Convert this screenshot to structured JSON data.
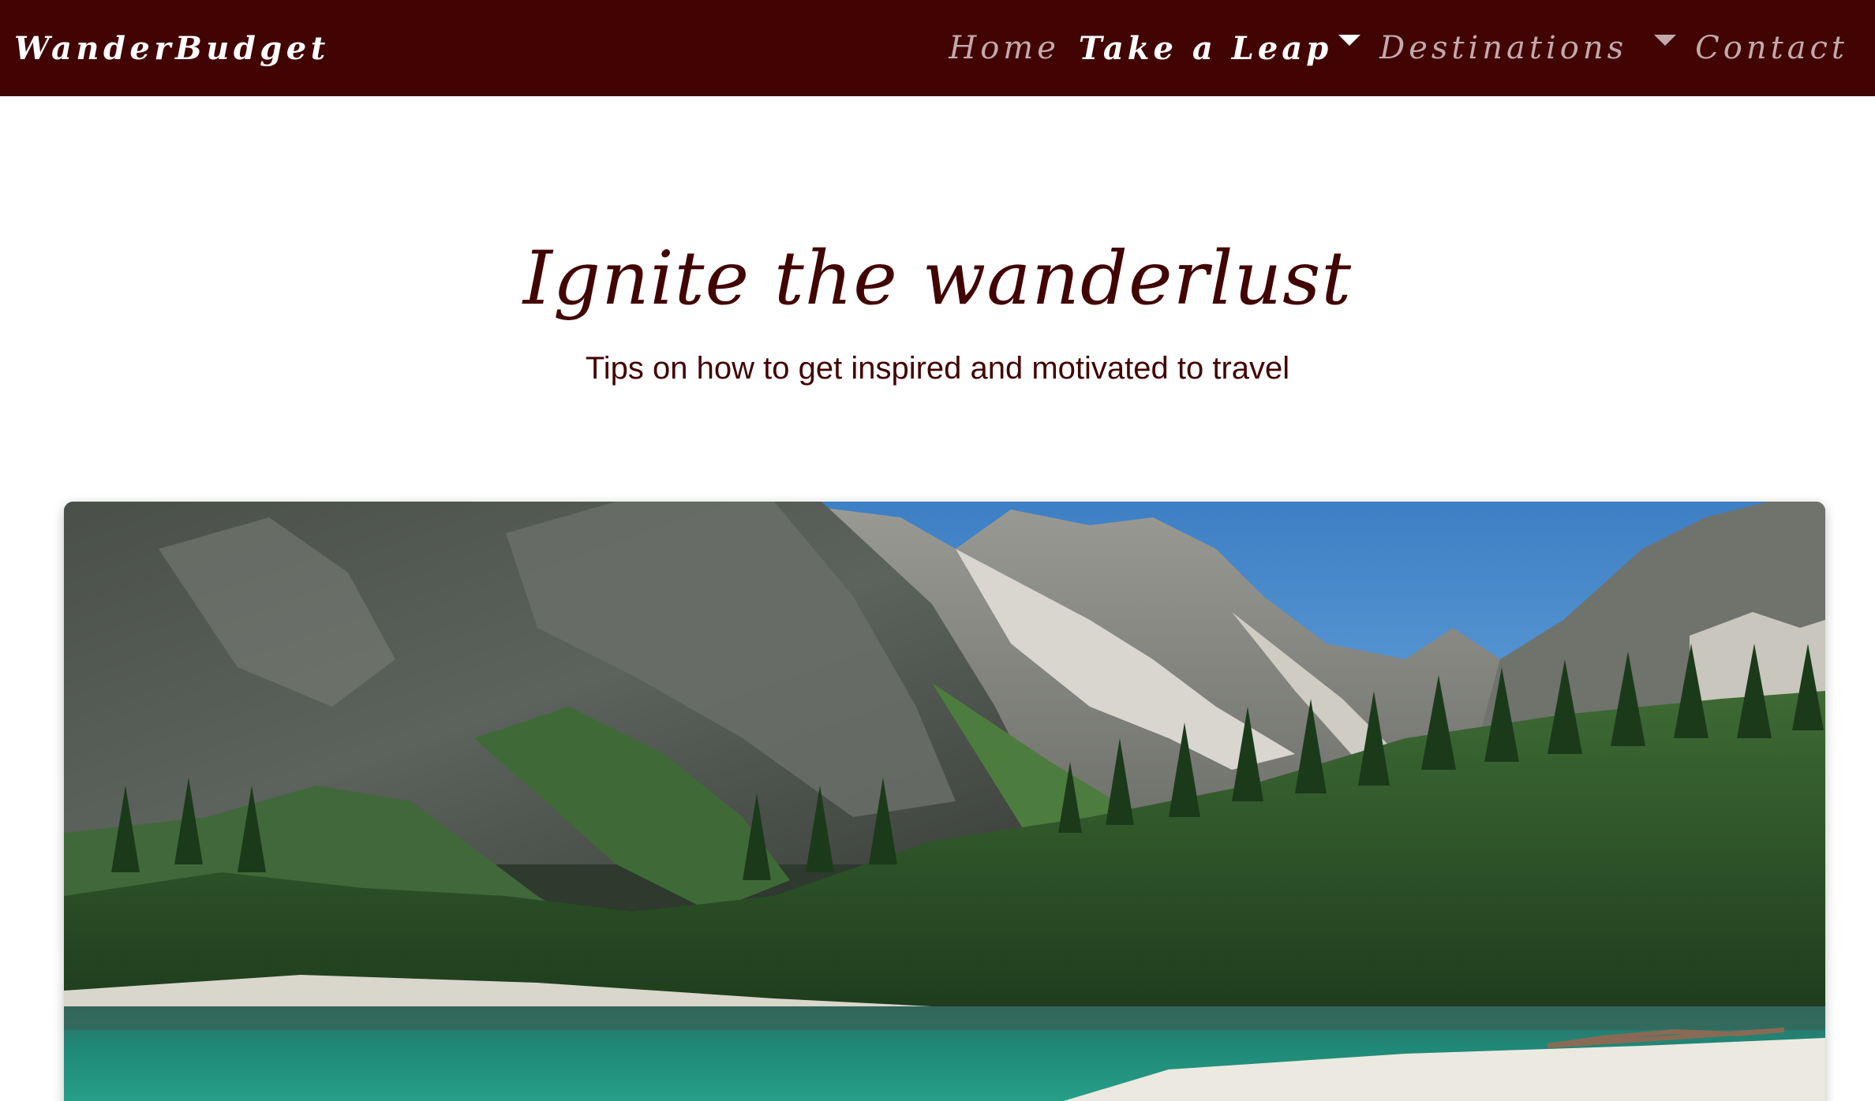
{
  "navbar": {
    "brand": "WanderBudget",
    "links": [
      {
        "label": "Home",
        "active": false,
        "dropdown": false
      },
      {
        "label": "Take a Leap",
        "active": true,
        "dropdown": true
      },
      {
        "label": "Destinations",
        "active": false,
        "dropdown": true
      },
      {
        "label": "Contact",
        "active": false,
        "dropdown": false
      }
    ]
  },
  "hero": {
    "title": "Ignite the wanderlust",
    "subtitle": "Tips on how to get inspired and motivated to travel"
  },
  "colors": {
    "navbar_bg": "#420303",
    "heading_text": "#420303",
    "nav_active": "#ffffff",
    "nav_inactive": "#c3aaaa"
  }
}
